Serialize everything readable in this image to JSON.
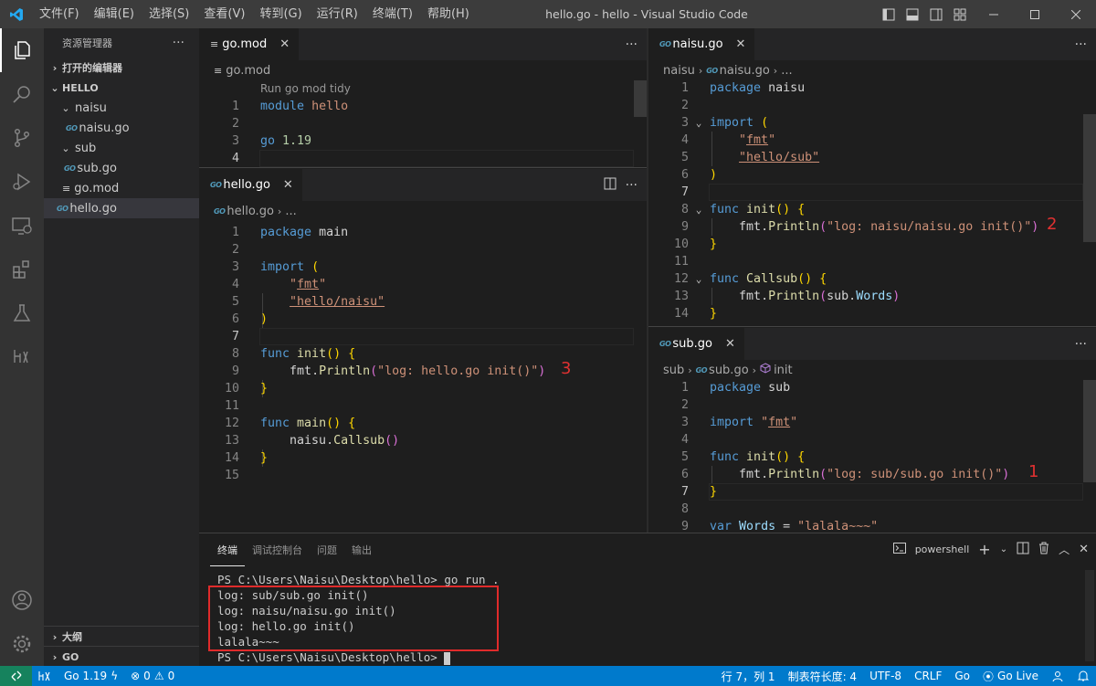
{
  "titlebar": {
    "menu": [
      "文件(F)",
      "编辑(E)",
      "选择(S)",
      "查看(V)",
      "转到(G)",
      "运行(R)",
      "终端(T)",
      "帮助(H)"
    ],
    "title": "hello.go - hello - Visual Studio Code"
  },
  "sidebar": {
    "header": "资源管理器",
    "open_editors": "打开的编辑器",
    "workspace": "HELLO",
    "tree": [
      {
        "label": "naisu",
        "type": "folder",
        "depth": 1
      },
      {
        "label": "naisu.go",
        "type": "go",
        "depth": 2
      },
      {
        "label": "sub",
        "type": "folder",
        "depth": 1
      },
      {
        "label": "sub.go",
        "type": "go",
        "depth": 2
      },
      {
        "label": "go.mod",
        "type": "mod",
        "depth": 1
      },
      {
        "label": "hello.go",
        "type": "go",
        "depth": 1,
        "selected": true
      }
    ],
    "outline": "大纲",
    "go_section": "GO"
  },
  "editors": {
    "gomod": {
      "tab": "go.mod",
      "crumb": "go.mod",
      "codelens": "Run go mod tidy",
      "current_line": 4
    },
    "hello": {
      "tab": "hello.go",
      "crumb_file": "hello.go",
      "crumb_more": "...",
      "current_line": 7,
      "annotation": "3"
    },
    "naisu": {
      "tab": "naisu.go",
      "crumb_folder": "naisu",
      "crumb_file": "naisu.go",
      "crumb_more": "...",
      "current_line": 7,
      "annotation": "2"
    },
    "sub": {
      "tab": "sub.go",
      "crumb_folder": "sub",
      "crumb_file": "sub.go",
      "crumb_symbol": "init",
      "current_line": 7,
      "annotation": "1"
    }
  },
  "panel": {
    "tabs": [
      "终端",
      "调试控制台",
      "问题",
      "输出"
    ],
    "active_tab": "终端",
    "shell": "powershell",
    "terminal_lines": [
      "PS C:\\Users\\Naisu\\Desktop\\hello> go run .",
      "log: sub/sub.go init()",
      "log: naisu/naisu.go init()",
      "log: hello.go init()",
      "lalala~~~",
      "PS C:\\Users\\Naisu\\Desktop\\hello> "
    ]
  },
  "statusbar": {
    "go_version": "Go 1.19",
    "errors": "0",
    "warnings": "0",
    "position": "行 7，列 1",
    "tab_size": "制表符长度: 4",
    "encoding": "UTF-8",
    "eol": "CRLF",
    "language": "Go",
    "live": "Go Live"
  },
  "colors": {
    "accent": "#007acc",
    "keyword": "#569cd6",
    "string": "#ce9178",
    "function": "#dcdcaa",
    "annotation": "#e03131"
  }
}
